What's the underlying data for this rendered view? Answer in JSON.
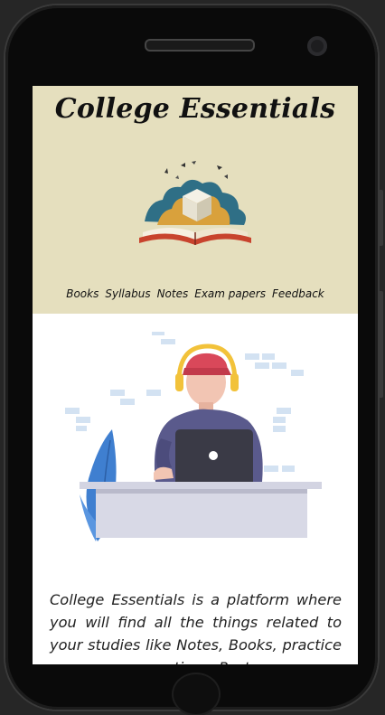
{
  "site": {
    "title": "College Essentials"
  },
  "nav": {
    "items": [
      "Books",
      "Syllabus",
      "Notes",
      "Exam papers",
      "Feedback"
    ]
  },
  "about": {
    "text": "College Essentials is a platform where you will find all the things related to your studies like Notes, Books, practice programs n questions, Past year exam"
  },
  "theme": {
    "header_bg": "#e5dfbe",
    "page_bg": "#ffffff",
    "frame_bg": "#262626"
  },
  "icons": {
    "logo": "open-book-icon",
    "hero": "student-with-laptop-illustration"
  }
}
